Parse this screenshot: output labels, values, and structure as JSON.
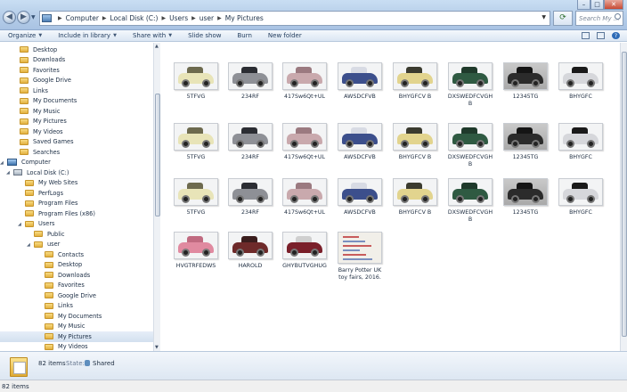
{
  "window": {
    "search_placeholder": "Search My ...",
    "breadcrumb": [
      "Computer",
      "Local Disk (C:)",
      "Users",
      "user",
      "My Pictures"
    ]
  },
  "toolbar": {
    "organize": "Organize",
    "include_in_library": "Include in library",
    "share_with": "Share with",
    "slide_show": "Slide show",
    "burn": "Burn",
    "new_folder": "New folder"
  },
  "sidebar": {
    "items": [
      {
        "label": "Desktop",
        "icon": "folder-icon"
      },
      {
        "label": "Downloads",
        "icon": "folder-icon"
      },
      {
        "label": "Favorites",
        "icon": "folder-icon"
      },
      {
        "label": "Google Drive",
        "icon": "folder-icon"
      },
      {
        "label": "Links",
        "icon": "folder-icon"
      },
      {
        "label": "My Documents",
        "icon": "folder-icon"
      },
      {
        "label": "My Music",
        "icon": "folder-icon"
      },
      {
        "label": "My Pictures",
        "icon": "folder-icon"
      },
      {
        "label": "My Videos",
        "icon": "folder-icon"
      },
      {
        "label": "Saved Games",
        "icon": "folder-icon"
      },
      {
        "label": "Searches",
        "icon": "folder-icon"
      },
      {
        "label": "Computer",
        "icon": "computer-icon"
      },
      {
        "label": "Local Disk (C:)",
        "icon": "drive-icon"
      },
      {
        "label": "My Web Sites",
        "icon": "folder-icon"
      },
      {
        "label": "PerfLogs",
        "icon": "folder-icon"
      },
      {
        "label": "Program Files",
        "icon": "folder-icon"
      },
      {
        "label": "Program Files (x86)",
        "icon": "folder-icon"
      },
      {
        "label": "Users",
        "icon": "folder-icon"
      },
      {
        "label": "Public",
        "icon": "folder-icon"
      },
      {
        "label": "user",
        "icon": "folder-icon"
      },
      {
        "label": "Contacts",
        "icon": "folder-icon"
      },
      {
        "label": "Desktop",
        "icon": "folder-icon"
      },
      {
        "label": "Downloads",
        "icon": "folder-icon"
      },
      {
        "label": "Favorites",
        "icon": "folder-icon"
      },
      {
        "label": "Google Drive",
        "icon": "folder-icon"
      },
      {
        "label": "Links",
        "icon": "folder-icon"
      },
      {
        "label": "My Documents",
        "icon": "folder-icon"
      },
      {
        "label": "My Music",
        "icon": "folder-icon"
      },
      {
        "label": "My Pictures",
        "icon": "folder-icon"
      },
      {
        "label": "My Videos",
        "icon": "folder-icon"
      }
    ],
    "selected_label": "My Pictures"
  },
  "files": [
    {
      "name": "5TFVG",
      "body": "#e8e4b8",
      "roof": "#6d6a4e"
    },
    {
      "name": "234RF",
      "body": "#8e9096",
      "roof": "#2b2d33"
    },
    {
      "name": "417Sw6Qt+UL",
      "body": "#c9a9ad",
      "roof": "#9b7a80"
    },
    {
      "name": "AWSDCFVB",
      "body": "#3c4f8c",
      "roof": "#d8dbe4"
    },
    {
      "name": "BHYGFCV B",
      "body": "#e2d48e",
      "roof": "#3b3b2f"
    },
    {
      "name": "DXSWEDFCVGHB",
      "body": "#2f5a42",
      "roof": "#1f3a2b"
    },
    {
      "name": "12345TG",
      "body": "#2b2b2b",
      "roof": "#151515",
      "grey": true
    },
    {
      "name": "BHYGFC",
      "body": "#d6d7db",
      "roof": "#1a1a1a"
    },
    {
      "name": "5TFVG",
      "body": "#e8e4b8",
      "roof": "#6d6a4e"
    },
    {
      "name": "234RF",
      "body": "#8e9096",
      "roof": "#2b2d33"
    },
    {
      "name": "417Sw6Qt+UL",
      "body": "#c9a9ad",
      "roof": "#9b7a80"
    },
    {
      "name": "AWSDCFVB",
      "body": "#3c4f8c",
      "roof": "#d8dbe4"
    },
    {
      "name": "BHYGFCV B",
      "body": "#e2d48e",
      "roof": "#3b3b2f"
    },
    {
      "name": "DXSWEDFCVGHB",
      "body": "#2f5a42",
      "roof": "#1f3a2b"
    },
    {
      "name": "12345TG",
      "body": "#2b2b2b",
      "roof": "#151515",
      "grey": true
    },
    {
      "name": "BHYGFC",
      "body": "#d6d7db",
      "roof": "#1a1a1a"
    },
    {
      "name": "5TFVG",
      "body": "#e8e4b8",
      "roof": "#6d6a4e"
    },
    {
      "name": "234RF",
      "body": "#8e9096",
      "roof": "#2b2d33"
    },
    {
      "name": "417Sw6Qt+UL",
      "body": "#c9a9ad",
      "roof": "#9b7a80"
    },
    {
      "name": "AWSDCFVB",
      "body": "#3c4f8c",
      "roof": "#d8dbe4"
    },
    {
      "name": "BHYGFCV B",
      "body": "#e2d48e",
      "roof": "#3b3b2f"
    },
    {
      "name": "DXSWEDFCVGHB",
      "body": "#2f5a42",
      "roof": "#1f3a2b"
    },
    {
      "name": "12345TG",
      "body": "#2b2b2b",
      "roof": "#151515",
      "grey": true
    },
    {
      "name": "BHYGFC",
      "body": "#d6d7db",
      "roof": "#1a1a1a"
    },
    {
      "name": "HVGTRFEDWS",
      "body": "#e08aa0",
      "roof": "#c06a80"
    },
    {
      "name": "HAROLD",
      "body": "#6e2a2a",
      "roof": "#3a1d1d"
    },
    {
      "name": "GHYBUTVGHUG",
      "body": "#7a1f2a",
      "roof": "#cfcfcf"
    },
    {
      "name": "Barry Potter UK toy fairs, 2016.",
      "doc": true
    }
  ],
  "details": {
    "item_count": "82 items",
    "state_label": "State:",
    "state_value": "Shared"
  },
  "statusbar": {
    "text": "82 items"
  }
}
